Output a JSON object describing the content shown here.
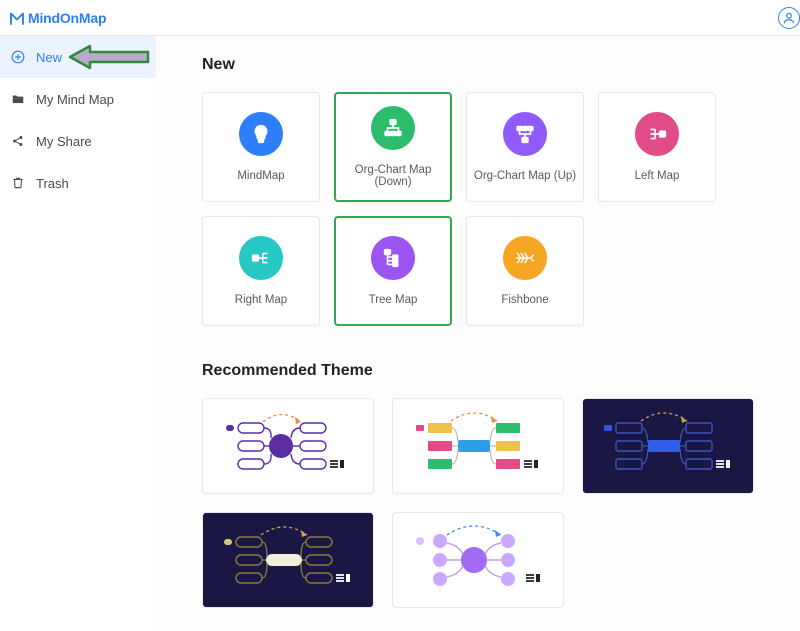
{
  "app": {
    "name": "MindOnMap"
  },
  "sidebar": {
    "items": [
      {
        "label": "New",
        "icon": "plus-circle-icon",
        "active": true
      },
      {
        "label": "My Mind Map",
        "icon": "folder-icon"
      },
      {
        "label": "My Share",
        "icon": "share-icon"
      },
      {
        "label": "Trash",
        "icon": "trash-icon"
      }
    ]
  },
  "sections": {
    "new_title": "New",
    "theme_title": "Recommended Theme"
  },
  "templates": [
    {
      "label": "MindMap",
      "color": "#2d7ff9",
      "icon": "lightbulb",
      "selected": false
    },
    {
      "label": "Org-Chart Map (Down)",
      "color": "#2bbd6b",
      "icon": "org-down",
      "selected": true
    },
    {
      "label": "Org-Chart Map (Up)",
      "color": "#8f5bff",
      "icon": "org-up",
      "selected": false
    },
    {
      "label": "Left Map",
      "color": "#e24c86",
      "icon": "left-map",
      "selected": false
    },
    {
      "label": "Right Map",
      "color": "#27c8c3",
      "icon": "right-map",
      "selected": false
    },
    {
      "label": "Tree Map",
      "color": "#9d55f2",
      "icon": "tree-map",
      "selected": true
    },
    {
      "label": "Fishbone",
      "color": "#f5a623",
      "icon": "fishbone",
      "selected": false
    }
  ],
  "themes": [
    {
      "id": "theme-purple-light",
      "variant": "light"
    },
    {
      "id": "theme-multicolor-light",
      "variant": "light"
    },
    {
      "id": "theme-navy-dark",
      "variant": "dark"
    },
    {
      "id": "theme-navy-dark-2",
      "variant": "dark"
    },
    {
      "id": "theme-lilac-light",
      "variant": "light"
    }
  ],
  "colors": {
    "accent": "#2d7ff9",
    "selected_border": "#33a852"
  }
}
